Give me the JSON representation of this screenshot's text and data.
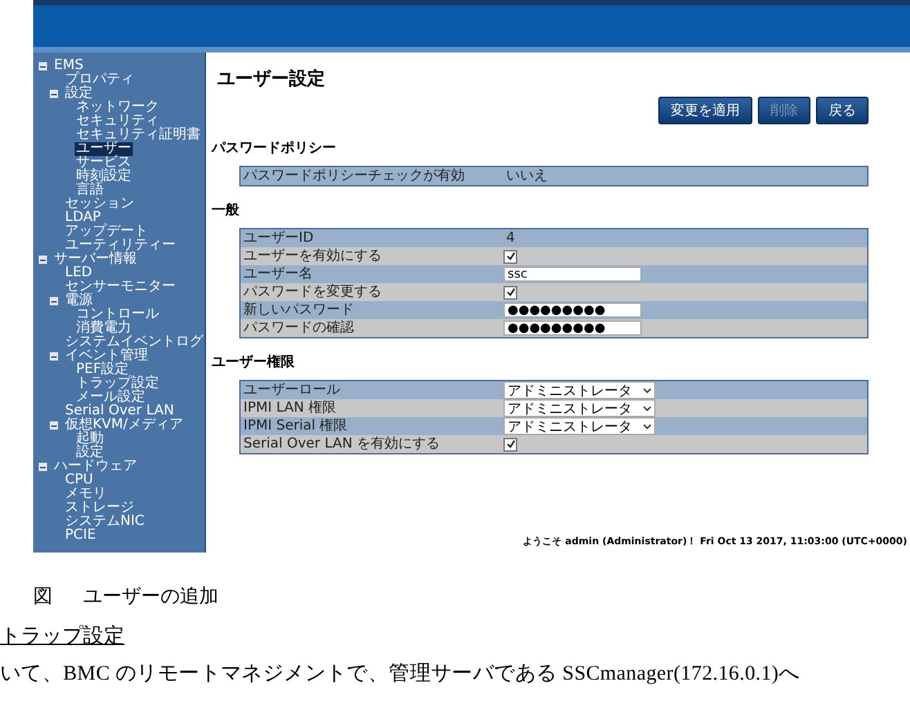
{
  "sidebar": {
    "items": [
      {
        "label": "EMS",
        "selected": false,
        "expanded": true,
        "children": [
          {
            "label": "プロパティ",
            "selected": false
          },
          {
            "label": "設定",
            "selected": false,
            "expanded": true,
            "children": [
              {
                "label": "ネットワーク",
                "selected": false
              },
              {
                "label": "セキュリティ",
                "selected": false
              },
              {
                "label": "セキュリティ証明書",
                "selected": false
              },
              {
                "label": "ユーザー",
                "selected": true
              },
              {
                "label": "サービス",
                "selected": false
              },
              {
                "label": "時刻設定",
                "selected": false
              },
              {
                "label": "言語",
                "selected": false
              }
            ]
          },
          {
            "label": "セッション",
            "selected": false
          },
          {
            "label": "LDAP",
            "selected": false
          },
          {
            "label": "アップデート",
            "selected": false
          },
          {
            "label": "ユーティリティー",
            "selected": false
          }
        ]
      },
      {
        "label": "サーバー情報",
        "selected": false,
        "expanded": true,
        "children": [
          {
            "label": "LED",
            "selected": false
          },
          {
            "label": "センサーモニター",
            "selected": false
          },
          {
            "label": "電源",
            "selected": false,
            "expanded": true,
            "children": [
              {
                "label": "コントロール",
                "selected": false
              },
              {
                "label": "消費電力",
                "selected": false
              }
            ]
          },
          {
            "label": "システムイベントログ",
            "selected": false
          },
          {
            "label": "イベント管理",
            "selected": false,
            "expanded": true,
            "children": [
              {
                "label": "PEF設定",
                "selected": false
              },
              {
                "label": "トラップ設定",
                "selected": false
              },
              {
                "label": "メール設定",
                "selected": false
              }
            ]
          },
          {
            "label": "Serial Over LAN",
            "selected": false
          },
          {
            "label": "仮想KVM/メディア",
            "selected": false,
            "expanded": true,
            "children": [
              {
                "label": "起動",
                "selected": false
              },
              {
                "label": "設定",
                "selected": false
              }
            ]
          }
        ]
      },
      {
        "label": "ハードウェア",
        "selected": false,
        "expanded": true,
        "children": [
          {
            "label": "CPU",
            "selected": false
          },
          {
            "label": "メモリ",
            "selected": false
          },
          {
            "label": "ストレージ",
            "selected": false
          },
          {
            "label": "システムNIC",
            "selected": false
          },
          {
            "label": "PCIE",
            "selected": false
          }
        ]
      }
    ]
  },
  "page_title": "ユーザー設定",
  "buttons": [
    {
      "label": "変更を適用",
      "disabled": false
    },
    {
      "label": "削除",
      "disabled": true
    },
    {
      "label": "戻る",
      "disabled": false
    }
  ],
  "sections": [
    {
      "title": "パスワードポリシー",
      "rows": [
        {
          "kind": "text",
          "label": "パスワードポリシーチェックが有効",
          "value": "いいえ"
        }
      ]
    },
    {
      "title": "一般",
      "rows": [
        {
          "kind": "text",
          "label": "ユーザーID",
          "value": "4"
        },
        {
          "kind": "checkbox",
          "label": "ユーザーを有効にする",
          "checked": true
        },
        {
          "kind": "input",
          "label": "ユーザー名",
          "value": "ssc"
        },
        {
          "kind": "checkbox",
          "label": "パスワードを変更する",
          "checked": true
        },
        {
          "kind": "input",
          "label": "新しいパスワード",
          "value": "●●●●●●●●●"
        },
        {
          "kind": "input",
          "label": "パスワードの確認",
          "value": "●●●●●●●●●"
        }
      ]
    },
    {
      "title": "ユーザー権限",
      "rows": [
        {
          "kind": "select",
          "label": "ユーザーロール",
          "value": "アドミニストレータ"
        },
        {
          "kind": "select",
          "label": "IPMI LAN 権限",
          "value": "アドミニストレータ"
        },
        {
          "kind": "select",
          "label": "IPMI Serial 権限",
          "value": "アドミニストレータ"
        },
        {
          "kind": "checkbox",
          "label": "Serial Over LAN を有効にする",
          "checked": true
        }
      ]
    }
  ],
  "status": "ようこそ admin (Administrator)！ Fri Oct 13 2017, 11:03:00 (UTC+0000)",
  "document": {
    "caption_label": "図",
    "caption": "ユーザーの追加",
    "heading": "トラップ設定",
    "body": "いて、BMC のリモートマネジメントで、管理サーバである SSCmanager(172.16.0.1)へ"
  }
}
